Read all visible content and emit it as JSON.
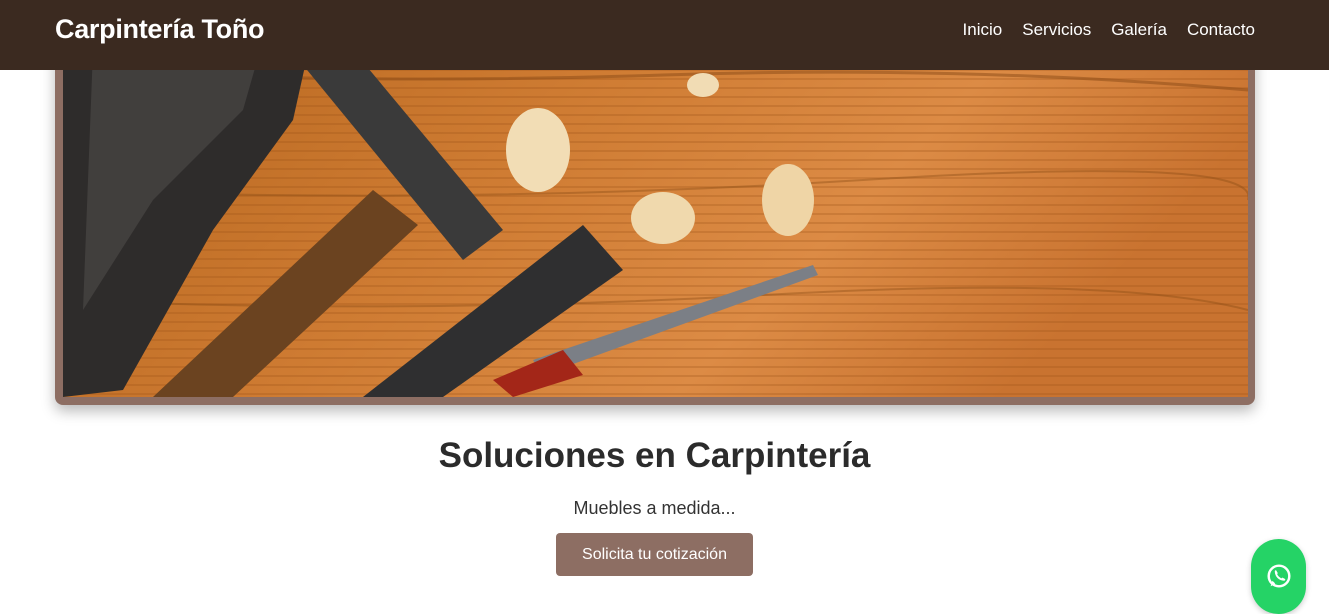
{
  "navbar": {
    "brand": "Carpintería Toño",
    "links": [
      "Inicio",
      "Servicios",
      "Galería",
      "Contacto"
    ]
  },
  "hero": {
    "image_icon": "carpentry-tools-photo",
    "title": "Soluciones en Carpintería",
    "subtitle": "Muebles a medida...",
    "cta_label": "Solicita tu cotización"
  },
  "floating": {
    "icon": "whatsapp-icon"
  },
  "colors": {
    "navbar_bg": "#3b2a20",
    "accent": "#8d6e63",
    "whatsapp": "#25d366",
    "text_dark": "#2b2b2b"
  }
}
